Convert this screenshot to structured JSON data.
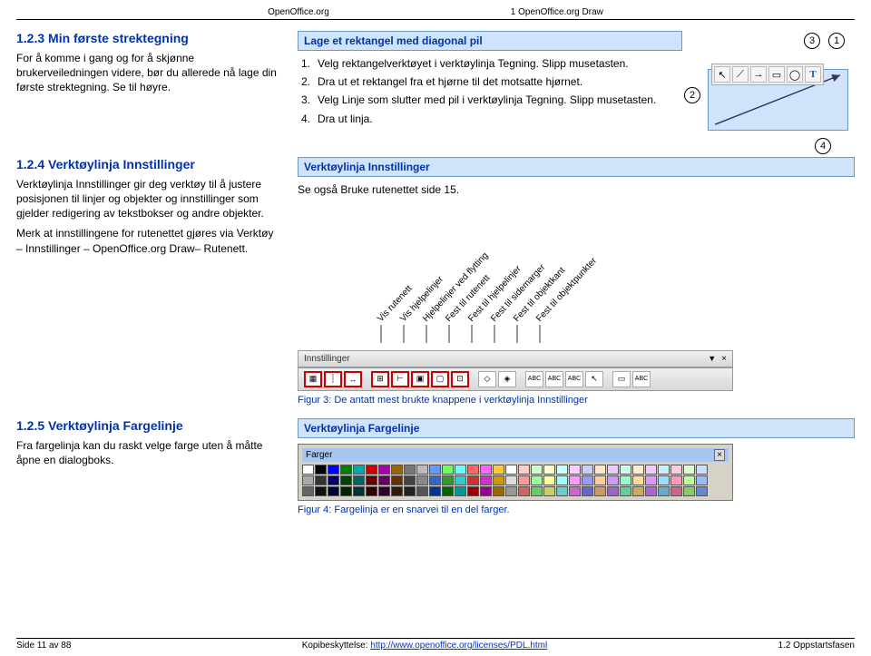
{
  "header": {
    "left": "OpenOffice.org",
    "right": "1 OpenOffice.org Draw"
  },
  "s1": {
    "heading": "1.2.3 Min første strektegning",
    "para": "For å komme i gang og for å skjønne brukerveiledningen videre, bør du allerede nå lage din første strektegning. Se til høyre."
  },
  "s1r": {
    "title": "Lage et rektangel med diagonal pil",
    "steps": [
      "Velg rektangelverktøyet i verktøylinja Tegning. Slipp  musetasten.",
      "Dra ut et rektangel fra et hjørne til det motsatte hjørnet.",
      "Velg Linje som slutter med pil i verktøylinja Tegning. Slipp musetasten.",
      "Dra ut linja."
    ],
    "callouts": {
      "c1": "1",
      "c2": "2",
      "c3": "3",
      "c4": "4"
    },
    "tools": {
      "t1": "↖",
      "t2": "⟋",
      "t3": "→",
      "t4": "▭",
      "t5": "◯",
      "t6": "T"
    }
  },
  "s2": {
    "heading": "1.2.4 Verktøylinja Innstillinger",
    "para1": "Verktøylinja Innstillinger gir deg verktøy til å justere posisjonen til linjer og objekter og innstillinger som gjelder redigering av tekstbokser og andre objekter.",
    "para2": "Merk at innstillingene for rutenettet gjøres via Verktøy – Innstillinger – OpenOffice.org Draw– Rutenett."
  },
  "s2r": {
    "title": "Verktøylinja Innstillinger",
    "see": "Se også Bruke rutenettet side 15.",
    "labels": [
      "Vis rutenett",
      "Vis hjelpelinjer",
      "Hjelpelinjer ved flytting",
      "Fest til rutenett",
      "Fest til hjelpelinjer",
      "Fest til sidemarger",
      "Fest til objektkant",
      "Fest til objektpunkter"
    ],
    "toolbar_label": "Innstillinger",
    "caption": "Figur 3: De antatt mest brukte knappene i verktøylinja Innstillinger"
  },
  "s3": {
    "heading": "1.2.5 Verktøylinja Fargelinje",
    "para": "Fra fargelinja kan du raskt velge farge uten å måtte åpne en dialogboks."
  },
  "s3r": {
    "title": "Verktøylinja Fargelinje",
    "panel_title": "Farger",
    "close": "×",
    "caption": "Figur 4: Fargelinja er en snarvei til en del farger.",
    "colors_row1": [
      "#ffffff",
      "#000000",
      "#0000ff",
      "#008000",
      "#00aaaa",
      "#cc0000",
      "#aa00aa",
      "#996600",
      "#777777",
      "#bbbbbb",
      "#6699ff",
      "#66ff66",
      "#66ffff",
      "#ff6666",
      "#ff66ff",
      "#ffcc33",
      "#ffffff",
      "#ffcccc",
      "#ccffcc",
      "#ffffcc",
      "#ccffff",
      "#ffccff",
      "#ccccff",
      "#ffe6cc",
      "#e6ccff",
      "#ccffee",
      "#ffeecc",
      "#eeccff",
      "#cceeff",
      "#ffccdd",
      "#ddffcc",
      "#ccddff"
    ],
    "colors_row2": [
      "#aaaaaa",
      "#333333",
      "#000066",
      "#004400",
      "#006666",
      "#660000",
      "#660066",
      "#663300",
      "#444444",
      "#888888",
      "#3366cc",
      "#339933",
      "#33cccc",
      "#cc3333",
      "#cc33cc",
      "#cc9900",
      "#dddddd",
      "#ff9999",
      "#99ff99",
      "#ffff99",
      "#99ffff",
      "#ff99ff",
      "#9999ff",
      "#ffcc99",
      "#cc99ff",
      "#99ffcc",
      "#ffdd99",
      "#dd99ff",
      "#99ddff",
      "#ff99bb",
      "#bbff99",
      "#99bbff"
    ],
    "colors_row3": [
      "#666666",
      "#111111",
      "#000033",
      "#002200",
      "#003333",
      "#330000",
      "#330033",
      "#331a00",
      "#222222",
      "#555555",
      "#003399",
      "#006600",
      "#009999",
      "#990000",
      "#990099",
      "#996600",
      "#999999",
      "#cc6666",
      "#66cc66",
      "#cccc66",
      "#66cccc",
      "#cc66cc",
      "#6666cc",
      "#cc9966",
      "#9966cc",
      "#66cc99",
      "#ccaa66",
      "#aa66cc",
      "#66aacc",
      "#cc6688",
      "#88cc66",
      "#6688cc"
    ]
  },
  "footer": {
    "left": "Side 11 av 88",
    "mid_label": "Kopibeskyttelse: ",
    "mid_url": "http://www.openoffice.org/licenses/PDL.html",
    "right": "1.2 Oppstartsfasen"
  },
  "abc": "ABC"
}
